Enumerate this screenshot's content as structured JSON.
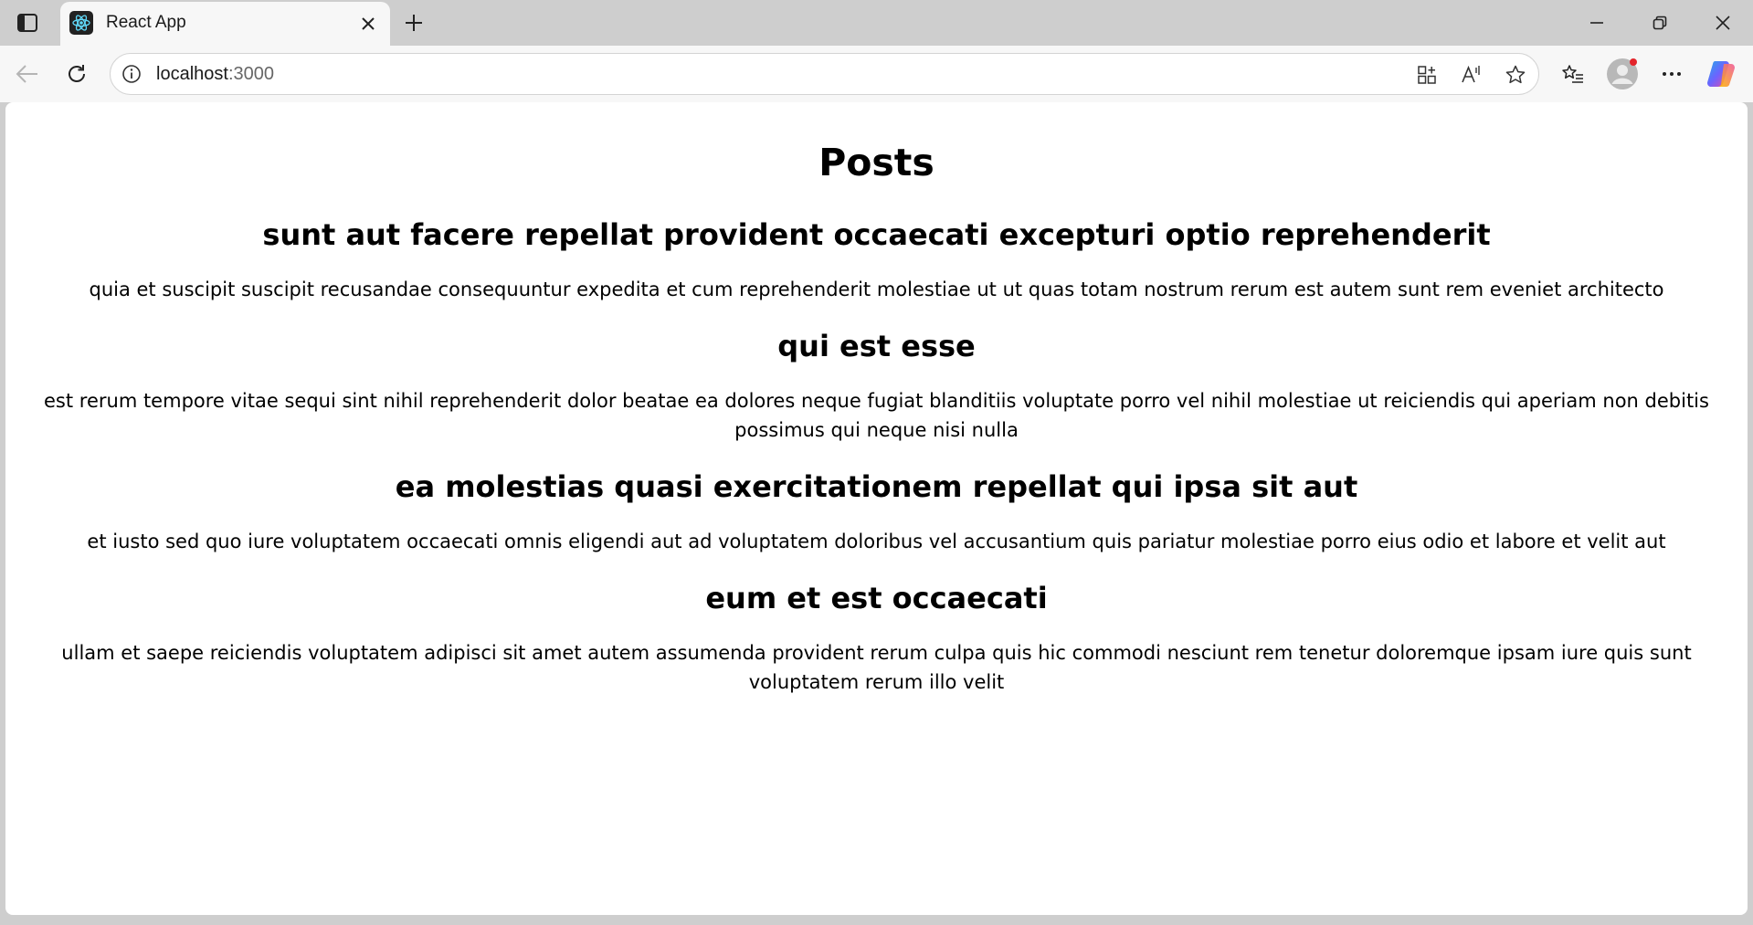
{
  "browser": {
    "tab": {
      "title": "React App"
    },
    "address": {
      "host": "localhost",
      "port": ":3000"
    }
  },
  "page": {
    "title": "Posts",
    "posts": [
      {
        "title": "sunt aut facere repellat provident occaecati excepturi optio reprehenderit",
        "body": "quia et suscipit suscipit recusandae consequuntur expedita et cum reprehenderit molestiae ut ut quas totam nostrum rerum est autem sunt rem eveniet architecto"
      },
      {
        "title": "qui est esse",
        "body": "est rerum tempore vitae sequi sint nihil reprehenderit dolor beatae ea dolores neque fugiat blanditiis voluptate porro vel nihil molestiae ut reiciendis qui aperiam non debitis possimus qui neque nisi nulla"
      },
      {
        "title": "ea molestias quasi exercitationem repellat qui ipsa sit aut",
        "body": "et iusto sed quo iure voluptatem occaecati omnis eligendi aut ad voluptatem doloribus vel accusantium quis pariatur molestiae porro eius odio et labore et velit aut"
      },
      {
        "title": "eum et est occaecati",
        "body": "ullam et saepe reiciendis voluptatem adipisci sit amet autem assumenda provident rerum culpa quis hic commodi nesciunt rem tenetur doloremque ipsam iure quis sunt voluptatem rerum illo velit"
      }
    ]
  },
  "colors": {
    "chrome": "#cecece",
    "toolbar": "#f7f7f7",
    "page_background": "#ffffff",
    "text": "#000000"
  }
}
